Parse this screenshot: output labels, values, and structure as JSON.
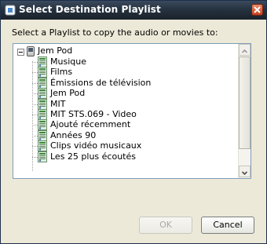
{
  "window": {
    "title": "Select Destination Playlist"
  },
  "prompt": "Select a Playlist to copy the audio or movies to:",
  "tree": {
    "root": {
      "label": "Jem Pod",
      "expanded": true
    },
    "playlists": [
      "Musique",
      "Films",
      "Émissions de télévision",
      "Jem Pod",
      "MIT",
      "MIT STS.069 - Video",
      "Ajouté récemment",
      "Années 90",
      "Clips vidéo musicaux",
      "Les 25 plus écoutés"
    ]
  },
  "buttons": {
    "ok": "OK",
    "cancel": "Cancel"
  },
  "colors": {
    "titlebar": "#26323f",
    "close": "#c4401e",
    "dialog_bg": "#ece9d8",
    "tree_border": "#7f9db9",
    "playlist_icon": "#3c8a3c"
  }
}
